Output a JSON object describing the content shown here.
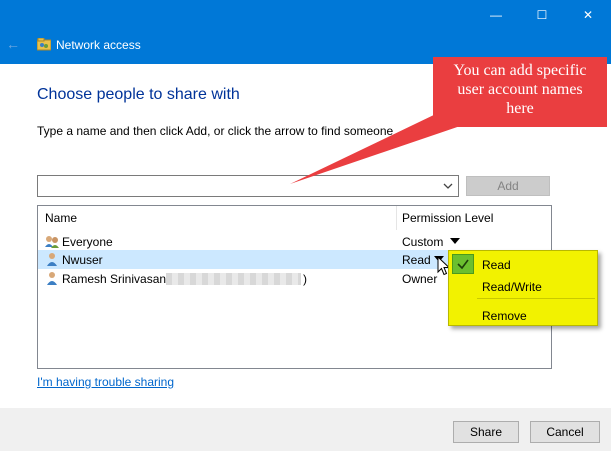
{
  "window": {
    "title": "Network access",
    "back_glyph": "←",
    "minimize_glyph": "—",
    "maximize_glyph": "☐",
    "close_glyph": "✕"
  },
  "main": {
    "heading": "Choose people to share with",
    "instruction": "Type a name and then click Add, or click the arrow to find someone",
    "name_input_value": "",
    "add_label": "Add"
  },
  "list": {
    "columns": {
      "name": "Name",
      "permission": "Permission Level"
    },
    "rows": [
      {
        "name": "Everyone",
        "permission": "Custom",
        "icon": "group-icon",
        "selected": false
      },
      {
        "name": "Nwuser",
        "permission": "Read",
        "icon": "user-icon",
        "selected": true
      },
      {
        "name": "Ramesh Srinivasan",
        "name_suffix": ")",
        "permission": "Owner",
        "icon": "user-icon",
        "selected": false
      }
    ]
  },
  "menu": {
    "items": [
      {
        "label": "Read",
        "checked": true
      },
      {
        "label": "Read/Write",
        "checked": false
      },
      {
        "label": "Remove",
        "checked": false
      }
    ],
    "highlight_color": "#f2f200",
    "check_color": "#6bbf2f"
  },
  "callout": {
    "lines": [
      "You can add specific",
      "user account names",
      "here"
    ],
    "color": "#ea3e40"
  },
  "footer": {
    "trouble_link": "I'm having trouble sharing",
    "share_label": "Share",
    "cancel_label": "Cancel"
  },
  "colors": {
    "title_bar": "#0078d7",
    "heading": "#003399",
    "selected_row": "#cce8ff",
    "link": "#0066cc"
  }
}
